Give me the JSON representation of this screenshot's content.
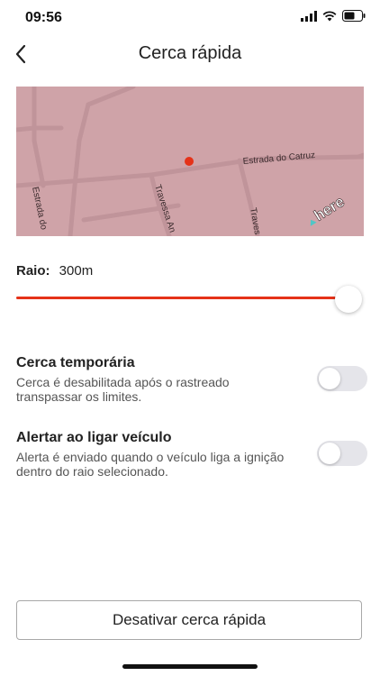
{
  "status_bar": {
    "time": "09:56",
    "signal_icon": "signal-bars-icon",
    "wifi_icon": "wifi-icon",
    "battery_icon": "battery-icon"
  },
  "header": {
    "title": "Cerca rápida",
    "back_icon": "chevron-left-icon"
  },
  "map": {
    "streets": [
      "Estrada do Catruz",
      "Travessa An",
      "Estrada do",
      "Traves"
    ],
    "logo": "here",
    "marker_color": "#e53219",
    "overlay_color": "#cfa3a8"
  },
  "radius": {
    "label": "Raio:",
    "value": "300m",
    "slider_fraction": 1.0
  },
  "settings": [
    {
      "title": "Cerca temporária",
      "description": "Cerca é desabilitada após o rastreado transpassar os limites.",
      "enabled": false
    },
    {
      "title": "Alertar ao ligar veículo",
      "description": "Alerta é enviado quando o veículo liga a ignição dentro do raio selecionado.",
      "enabled": false
    }
  ],
  "action": {
    "label": "Desativar cerca rápida"
  },
  "colors": {
    "accent": "#e53219",
    "toggle_off": "#e5e5ea"
  }
}
